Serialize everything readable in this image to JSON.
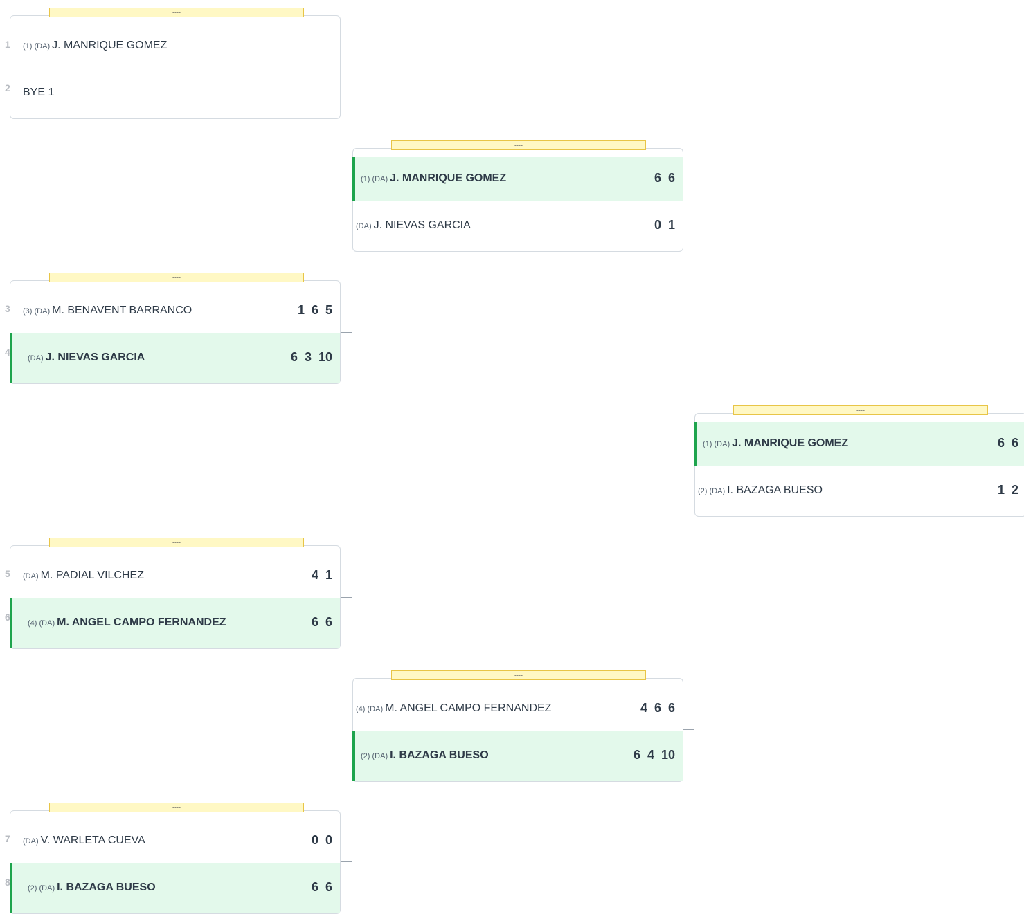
{
  "draw_numbers": [
    "1",
    "2",
    "3",
    "4",
    "5",
    "6",
    "7",
    "8"
  ],
  "rounds": [
    {
      "matches": [
        {
          "label": "----",
          "players": [
            {
              "seed": "(1) (DA)",
              "name": "J. MANRIQUE GOMEZ",
              "scores": [],
              "winner": false
            },
            {
              "seed": "",
              "name": "BYE 1",
              "scores": [],
              "winner": false
            }
          ]
        },
        {
          "label": "----",
          "players": [
            {
              "seed": "(3) (DA)",
              "name": "M. BENAVENT BARRANCO",
              "scores": [
                "1",
                "6",
                "5"
              ],
              "winner": false
            },
            {
              "seed": "(DA)",
              "name": "J. NIEVAS GARCIA",
              "scores": [
                "6",
                "3",
                "10"
              ],
              "winner": true
            }
          ]
        },
        {
          "label": "----",
          "players": [
            {
              "seed": "(DA)",
              "name": "M. PADIAL VILCHEZ",
              "scores": [
                "4",
                "1"
              ],
              "winner": false
            },
            {
              "seed": "(4) (DA)",
              "name": "M. ANGEL CAMPO FERNANDEZ",
              "scores": [
                "6",
                "6"
              ],
              "winner": true
            }
          ]
        },
        {
          "label": "----",
          "players": [
            {
              "seed": "(DA)",
              "name": "V. WARLETA CUEVA",
              "scores": [
                "0",
                "0"
              ],
              "winner": false
            },
            {
              "seed": "(2) (DA)",
              "name": "I. BAZAGA BUESO",
              "scores": [
                "6",
                "6"
              ],
              "winner": true
            }
          ]
        }
      ]
    },
    {
      "matches": [
        {
          "label": "----",
          "players": [
            {
              "seed": "(1) (DA)",
              "name": "J. MANRIQUE GOMEZ",
              "scores": [
                "6",
                "6"
              ],
              "winner": true
            },
            {
              "seed": "(DA)",
              "name": "J. NIEVAS GARCIA",
              "scores": [
                "0",
                "1"
              ],
              "winner": false
            }
          ]
        },
        {
          "label": "----",
          "players": [
            {
              "seed": "(4) (DA)",
              "name": "M. ANGEL CAMPO FERNANDEZ",
              "scores": [
                "4",
                "6",
                "6"
              ],
              "winner": false
            },
            {
              "seed": "(2) (DA)",
              "name": "I. BAZAGA BUESO",
              "scores": [
                "6",
                "4",
                "10"
              ],
              "winner": true
            }
          ]
        }
      ]
    },
    {
      "matches": [
        {
          "label": "----",
          "players": [
            {
              "seed": "(1) (DA)",
              "name": "J. MANRIQUE GOMEZ",
              "scores": [
                "6",
                "6"
              ],
              "winner": true
            },
            {
              "seed": "(2) (DA)",
              "name": "I. BAZAGA BUESO",
              "scores": [
                "1",
                "2"
              ],
              "winner": false
            }
          ]
        }
      ]
    }
  ]
}
